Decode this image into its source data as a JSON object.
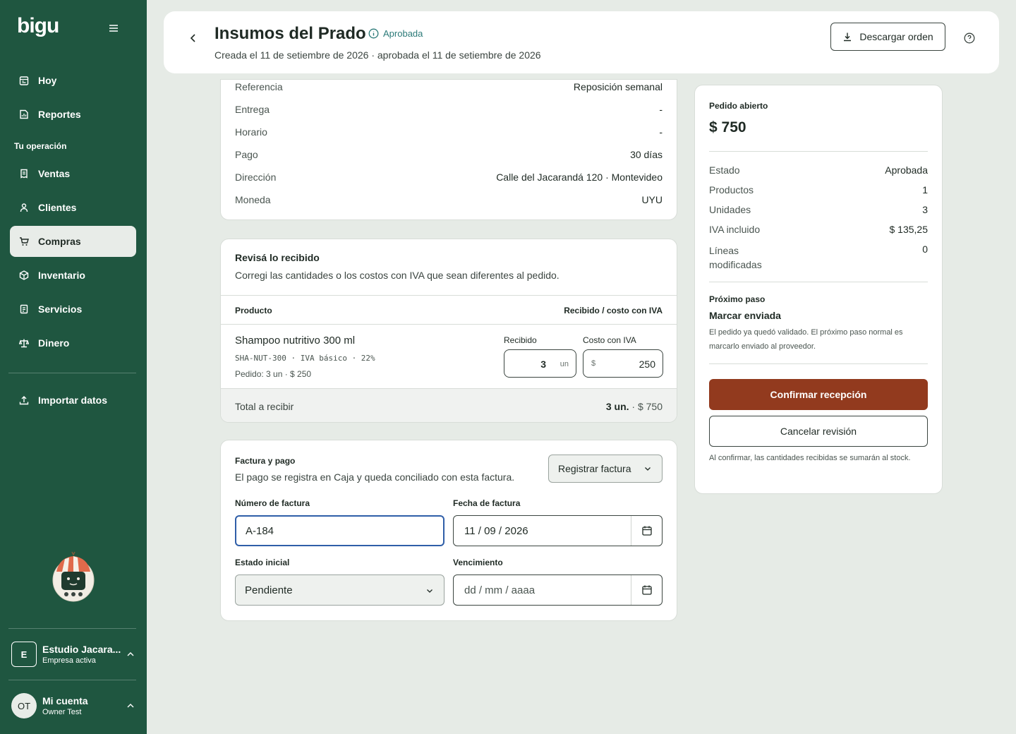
{
  "sidebar": {
    "logo": "bigu",
    "items": [
      {
        "label": "Hoy",
        "icon": "calendar-icon"
      },
      {
        "label": "Reportes",
        "icon": "report-icon"
      }
    ],
    "section_label": "Tu operación",
    "ops": [
      {
        "label": "Ventas",
        "icon": "receipt-icon"
      },
      {
        "label": "Clientes",
        "icon": "user-icon"
      },
      {
        "label": "Compras",
        "icon": "cart-icon",
        "active": true
      },
      {
        "label": "Inventario",
        "icon": "box-icon"
      },
      {
        "label": "Servicios",
        "icon": "document-icon"
      },
      {
        "label": "Dinero",
        "icon": "scale-icon"
      }
    ],
    "import_label": "Importar datos",
    "company": {
      "initial": "E",
      "name": "Estudio Jacara...",
      "sub": "Empresa activa"
    },
    "account": {
      "initials": "OT",
      "name": "Mi cuenta",
      "sub": "Owner Test"
    }
  },
  "header": {
    "title": "Insumos del Prado",
    "status": "Aprobada",
    "subtitle": "Creada el 11 de setiembre de 2026 · aprobada el 11 de setiembre de 2026",
    "download_label": "Descargar orden"
  },
  "info": {
    "rows": [
      {
        "key": "Referencia",
        "value": "Reposición semanal"
      },
      {
        "key": "Entrega",
        "value": "-"
      },
      {
        "key": "Horario",
        "value": "-"
      },
      {
        "key": "Pago",
        "value": "30 días"
      },
      {
        "key": "Dirección",
        "value": "Calle del Jacarandá 120 · Montevideo"
      },
      {
        "key": "Moneda",
        "value": "UYU"
      }
    ]
  },
  "review": {
    "title": "Revisá lo recibido",
    "description": "Corregi las cantidades o los costos con IVA que sean diferentes al pedido.",
    "col_product": "Producto",
    "col_received": "Recibido / costo con IVA",
    "product": {
      "name": "Shampoo nutritivo 300 ml",
      "sku": "SHA-NUT-300 · IVA básico · 22%",
      "order": "Pedido: 3 un · $ 250",
      "received_label": "Recibido",
      "received_value": "3",
      "received_unit": "un",
      "cost_label": "Costo con IVA",
      "cost_prefix": "$",
      "cost_value": "250"
    },
    "total_label": "Total a recibir",
    "total_units": "3 un.",
    "total_amount": "· $ 750"
  },
  "invoice": {
    "title": "Factura y pago",
    "description": "El pago se registra en Caja y queda conciliado con esta factura.",
    "register_label": "Registrar factura",
    "number_label": "Número de factura",
    "number_value": "A-184",
    "date_label": "Fecha de factura",
    "date_value": "11 / 09 / 2026",
    "state_label": "Estado inicial",
    "state_value": "Pendiente",
    "due_label": "Vencimiento",
    "due_placeholder": "dd / mm / aaaa"
  },
  "summary": {
    "label": "Pedido abierto",
    "amount": "$ 750",
    "rows": [
      {
        "key": "Estado",
        "value": "Aprobada"
      },
      {
        "key": "Productos",
        "value": "1"
      },
      {
        "key": "Unidades",
        "value": "3"
      },
      {
        "key": "IVA incluido",
        "value": "$ 135,25"
      }
    ],
    "modified_key_1": "Líneas",
    "modified_key_2": "modificadas",
    "modified_value": "0",
    "next_label": "Próximo paso",
    "next_title": "Marcar enviada",
    "next_desc": "El pedido ya quedó validado. El próximo paso normal es marcarlo enviado al proveedor.",
    "confirm_label": "Confirmar recepción",
    "cancel_label": "Cancelar revisión",
    "note": "Al confirmar, las cantidades recibidas se sumarán al stock."
  },
  "colors": {
    "sidebar": "#1f5640",
    "accent_button": "#923a1e",
    "status": "#2b7a78",
    "background": "#e6ebe6"
  }
}
